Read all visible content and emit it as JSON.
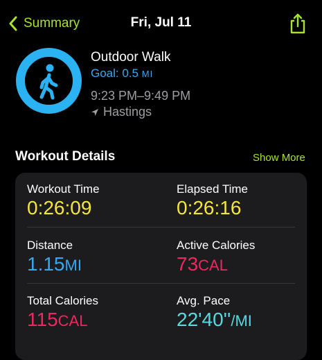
{
  "nav": {
    "back_label": "Summary",
    "title": "Fri, Jul 11"
  },
  "workout": {
    "name": "Outdoor Walk",
    "goal_label": "Goal: 0.5",
    "goal_unit": "MI",
    "time_range": "9:23 PM–9:49 PM",
    "location": "Hastings",
    "ring_color": "#2ab2f3"
  },
  "details": {
    "title": "Workout Details",
    "show_more": "Show More",
    "items": [
      {
        "label": "Workout Time",
        "value": "0:26:09",
        "unit": ""
      },
      {
        "label": "Elapsed Time",
        "value": "0:26:16",
        "unit": ""
      },
      {
        "label": "Distance",
        "value": "1.15",
        "unit": "MI"
      },
      {
        "label": "Active Calories",
        "value": "73",
        "unit": "CAL"
      },
      {
        "label": "Total Calories",
        "value": "115",
        "unit": "CAL"
      },
      {
        "label": "Avg. Pace",
        "value": "22'40''",
        "unit": "/MI"
      }
    ]
  },
  "colors": {
    "accent_green": "#a7e52a",
    "yellow": "#f5e63a",
    "blue": "#3aa7ef",
    "red": "#ea2a5e",
    "cyan": "#5ad8e0"
  }
}
